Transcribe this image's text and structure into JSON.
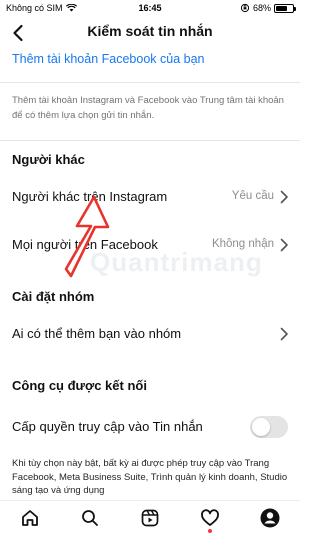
{
  "status_bar": {
    "carrier": "Không có SIM",
    "time": "16:45",
    "battery_text": "68%",
    "battery_level": 0.68
  },
  "header": {
    "title": "Kiểm soát tin nhắn"
  },
  "account_link": "Thêm tài khoản Facebook của bạn",
  "info_text": "Thêm tài khoản Instagram và Facebook vào Trung tâm tài khoản để có thêm lựa chọn gửi tin nhắn.",
  "others_section": {
    "title": "Người khác",
    "rows": [
      {
        "label": "Người khác trên Instagram",
        "value": "Yêu cầu"
      },
      {
        "label": "Mọi người trên Facebook",
        "value": "Không nhận"
      }
    ]
  },
  "group_section": {
    "title": "Cài đặt nhóm",
    "rows": [
      {
        "label": "Ai có thể thêm bạn vào nhóm",
        "value": ""
      }
    ]
  },
  "tools_section": {
    "title": "Công cụ được kết nối",
    "toggle_label": "Cấp quyền truy cập vào Tin nhắn",
    "toggle_on": false,
    "description": "Khi tùy chọn này bật, bất kỳ ai được phép truy cập vào Trang Facebook, Meta Business Suite, Trình quản lý kinh doanh, Studio sáng tạo và ứng dụng"
  },
  "watermark": "Quantrimang",
  "colors": {
    "link": "#1877f2",
    "secondary_text": "#8e8e8e",
    "arrow": "#e8332a",
    "notification": "#ff3040"
  },
  "tabbar": {
    "items": [
      "home-icon",
      "search-icon",
      "reels-icon",
      "heart-icon",
      "profile-icon"
    ]
  }
}
